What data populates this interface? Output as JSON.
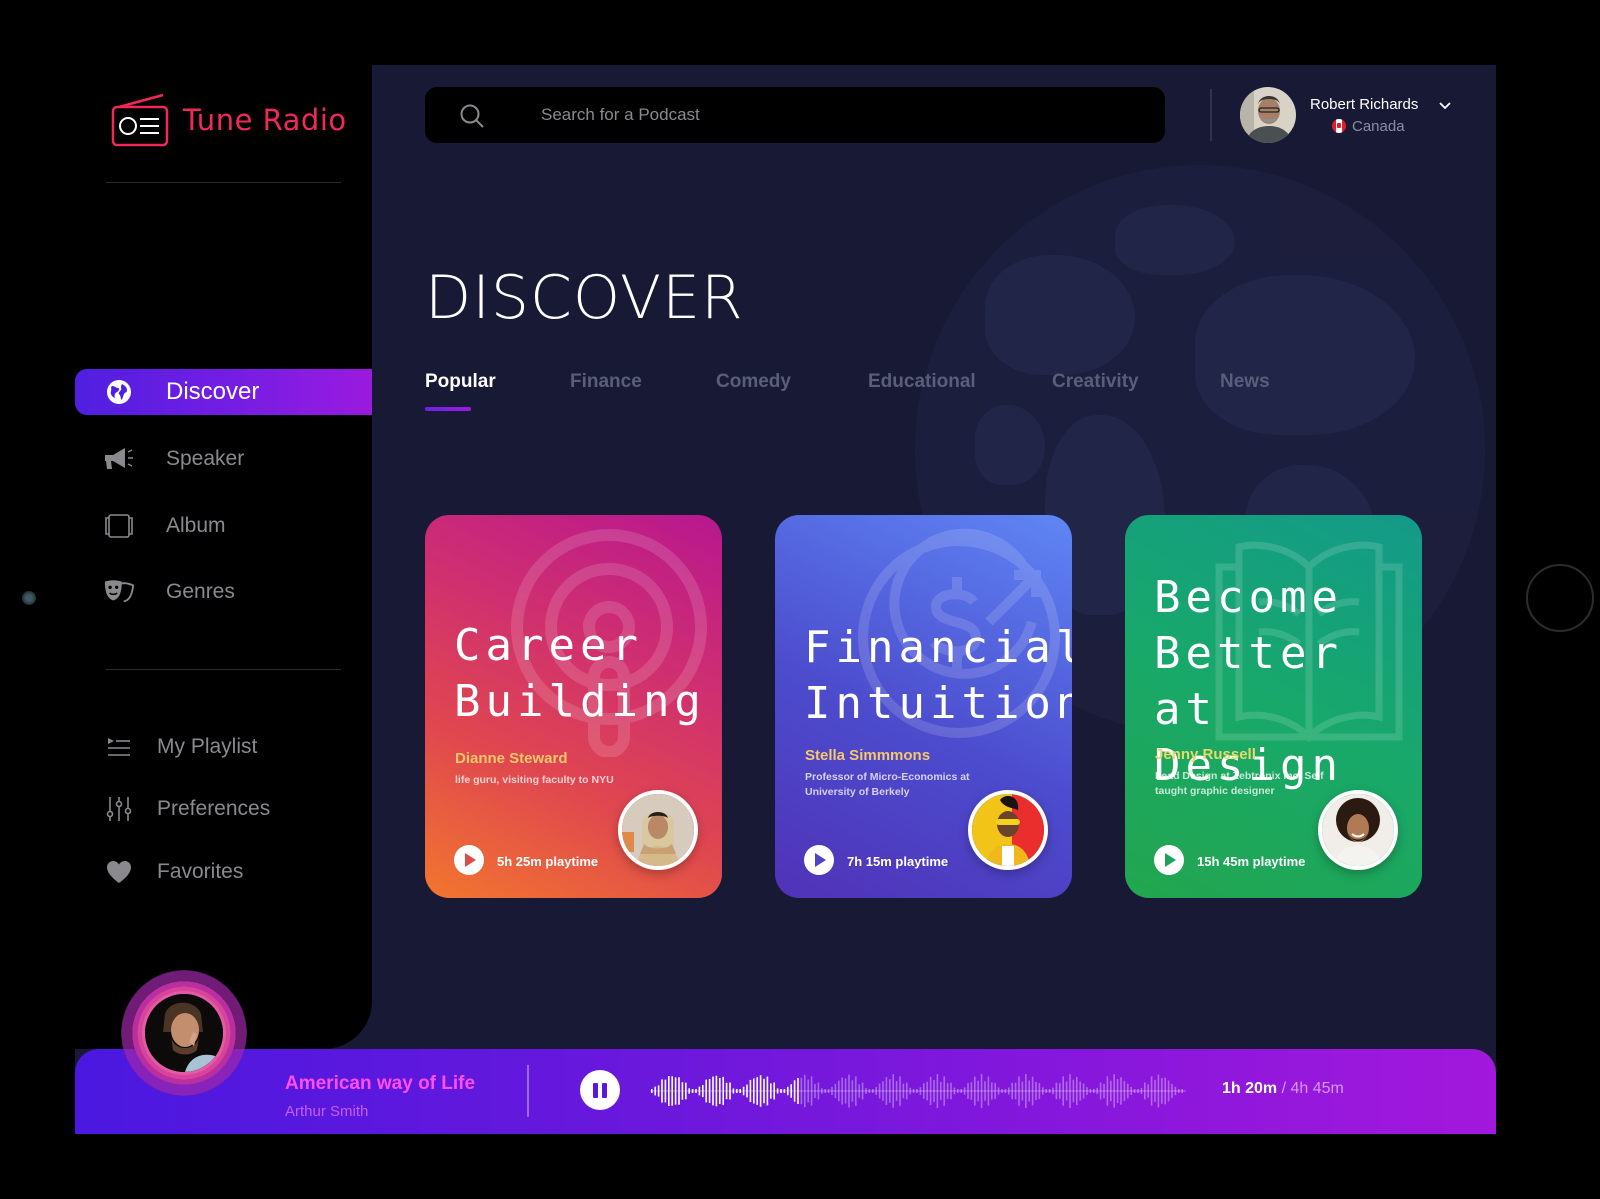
{
  "app": {
    "name": "Tune Radio",
    "brand_color": "#f2275a",
    "accent_gradient": [
      "#4f1fe0",
      "#9b1adf"
    ]
  },
  "sidebar": {
    "main_items": [
      {
        "label": "Discover",
        "icon": "globe-icon",
        "active": true
      },
      {
        "label": "Speaker",
        "icon": "megaphone-icon",
        "active": false
      },
      {
        "label": "Album",
        "icon": "album-icon",
        "active": false
      },
      {
        "label": "Genres",
        "icon": "theater-masks-icon",
        "active": false
      }
    ],
    "secondary_items": [
      {
        "label": "My Playlist",
        "icon": "playlist-icon"
      },
      {
        "label": "Preferences",
        "icon": "sliders-icon"
      },
      {
        "label": "Favorites",
        "icon": "heart-icon"
      }
    ]
  },
  "header": {
    "search_placeholder": "Search for a Podcast",
    "user": {
      "name": "Robert Richards",
      "country": "Canada"
    }
  },
  "main": {
    "title": "DISCOVER",
    "tabs": [
      {
        "label": "Popular",
        "active": true
      },
      {
        "label": "Finance",
        "active": false
      },
      {
        "label": "Comedy",
        "active": false
      },
      {
        "label": "Educational",
        "active": false
      },
      {
        "label": "Creativity",
        "active": false
      },
      {
        "label": "News",
        "active": false
      }
    ],
    "cards": [
      {
        "title": "Career\nBuilding",
        "author": "Dianne Steward",
        "bio": "life guru, visiting faculty to NYU",
        "playtime": "5h 25m playtime",
        "theme": "orange-pink",
        "decoration": "podcast-icon"
      },
      {
        "title": "Financial\nIntuition",
        "author": "Stella Simmmons",
        "bio": "Professor of Micro-Economics at University of Berkely",
        "playtime": "7h 15m playtime",
        "theme": "blue-purple",
        "decoration": "dollar-growth-icon"
      },
      {
        "title": "Become\nBetter at\nDesign",
        "author": "Jenny Russell",
        "bio": "Lead Design at Zebtronix Inc, Self taught graphic designer",
        "playtime": "15h 45m playtime",
        "theme": "green",
        "decoration": "open-book-icon"
      }
    ]
  },
  "player": {
    "track_title": "American way of Life",
    "artist": "Arthur Smith",
    "state": "playing",
    "elapsed": "1h 20m",
    "separator": "/",
    "total": "4h 45m",
    "progress": 0.28
  }
}
